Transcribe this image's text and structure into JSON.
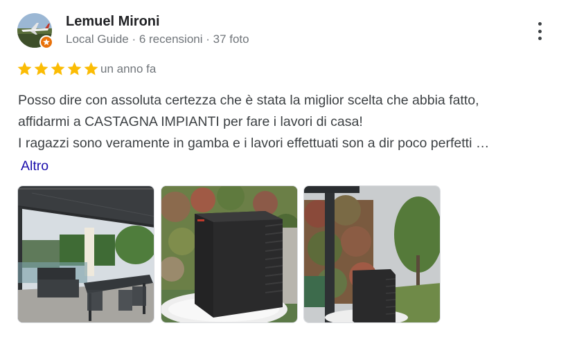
{
  "reviewer": {
    "name": "Lemuel Mironi",
    "meta": "Local Guide · 6 recensioni · 37 foto",
    "avatar_icon": "airplane-avatar",
    "badge_icon": "local-guide-badge-icon",
    "badge_color": "#e8710a"
  },
  "menu": {
    "icon": "more-vertical-icon"
  },
  "rating": {
    "stars": 5,
    "max": 5,
    "star_color": "#fbbc04"
  },
  "time_ago": "un anno fa",
  "review": {
    "lines": [
      "Posso dire con assoluta certezza che è stata la miglior scelta che abbia fatto,",
      "affidarmi a CASTAGNA IMPIANTI per fare i lavori di casa!",
      "I ragazzi sono veramente in gamba e i lavori effettuati son a dir poco perfetti …"
    ],
    "more_label": "Altro",
    "link_color": "#1a0dab"
  },
  "photos": [
    {
      "subject": "pergola-patio-furniture"
    },
    {
      "subject": "heat-pump-unit-white-stones"
    },
    {
      "subject": "heat-pump-unit-garden-post"
    }
  ]
}
